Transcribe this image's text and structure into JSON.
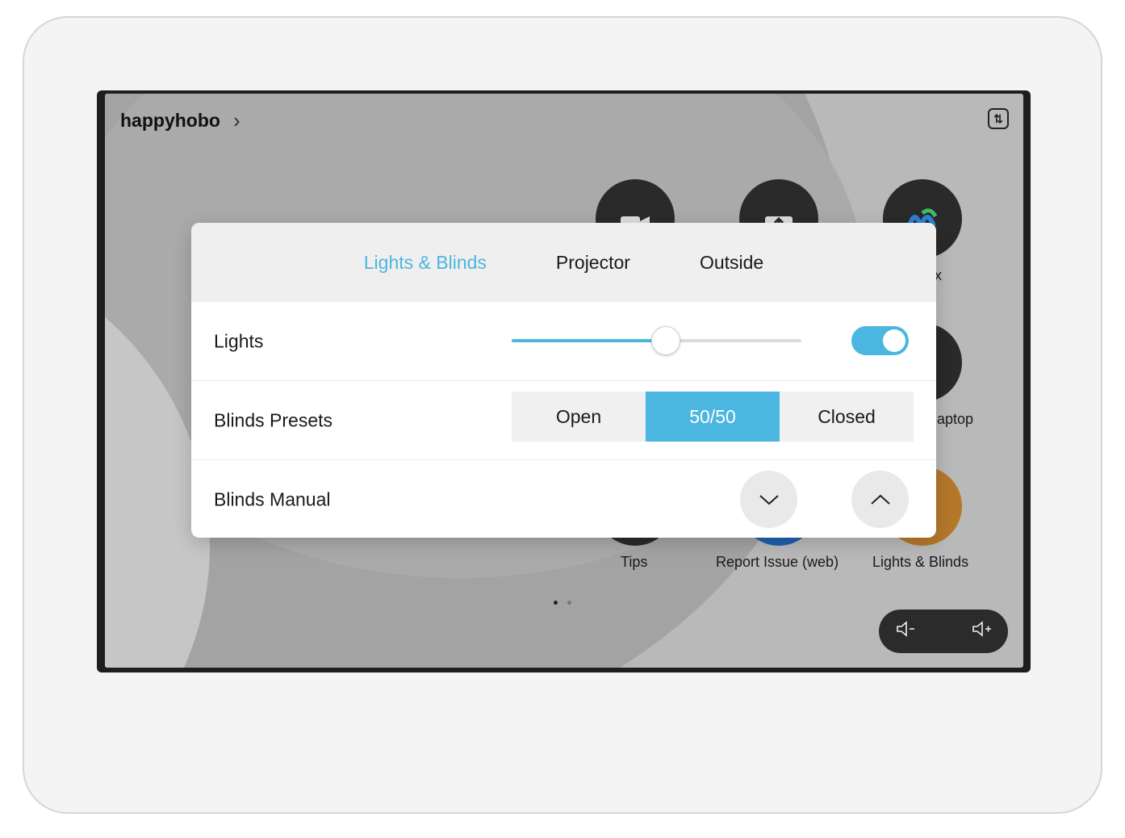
{
  "room": {
    "name": "happyhobo"
  },
  "panel": {
    "tabs": [
      {
        "label": "Lights & Blinds",
        "active": true
      },
      {
        "label": "Projector",
        "active": false
      },
      {
        "label": "Outside",
        "active": false
      }
    ],
    "lights": {
      "label": "Lights",
      "slider_level": 0.53,
      "toggle_on": true
    },
    "blinds_presets": {
      "label": "Blinds Presets",
      "options": [
        "Open",
        "50/50",
        "Closed"
      ],
      "selected": "50/50"
    },
    "blinds_manual": {
      "label": "Blinds Manual"
    }
  },
  "home_apps": [
    {
      "label": "Tips",
      "icon": "tips-icon"
    },
    {
      "label": "Report Issue (web)",
      "icon": "report-issue-icon"
    },
    {
      "label": "Lights & Blinds",
      "icon": "lights-blinds-icon"
    },
    {
      "label": "x",
      "icon": "webex-icon"
    },
    {
      "label": "aptop",
      "icon": "laptop-icon"
    }
  ],
  "colors": {
    "accent": "#4bb7e0",
    "lights_blinds_app": "#b5782b",
    "report_app": "#1f5fae"
  }
}
